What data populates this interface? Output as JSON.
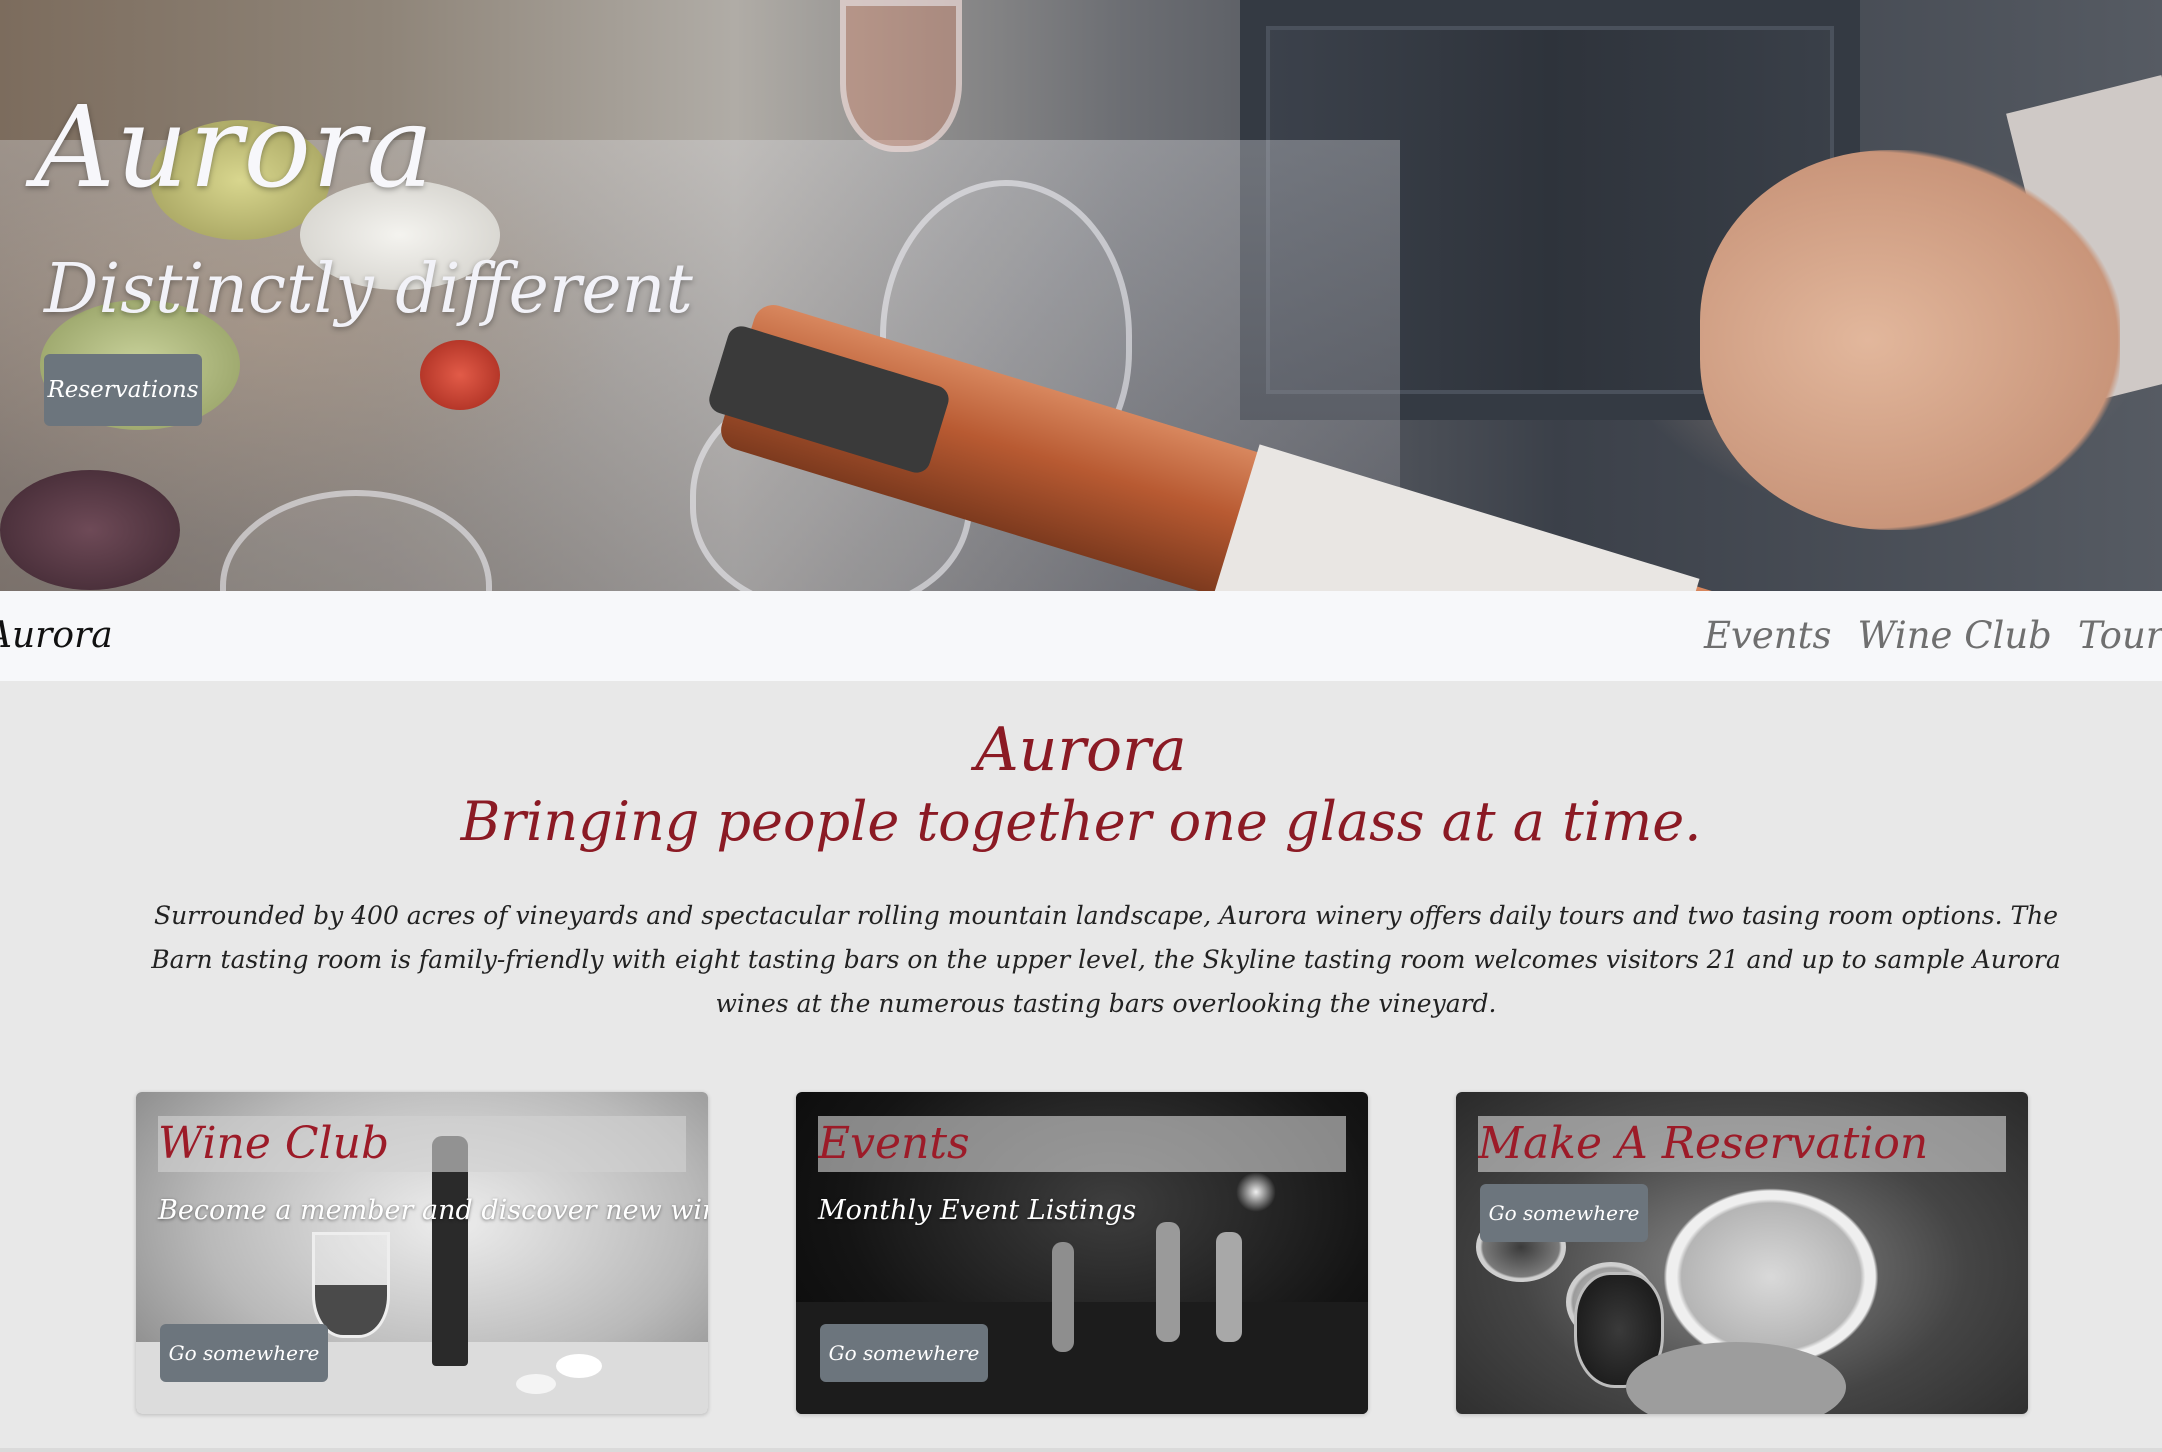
{
  "hero": {
    "title": "Aurora",
    "subtitle": "Distinctly different",
    "button_label": "Reservations"
  },
  "navbar": {
    "brand": "Aurora",
    "links": [
      {
        "label": "Events"
      },
      {
        "label": "Wine Club"
      },
      {
        "label": "Tours & Tasting"
      }
    ]
  },
  "intro": {
    "heading": "Aurora",
    "tagline": "Bringing people together one glass at a time.",
    "body": "Surrounded by 400 acres of vineyards and spectacular rolling mountain landscape, Aurora winery offers daily tours and two tasing room options. The Barn tasting room is family-friendly with eight tasting bars on the upper level, the Skyline tasting room welcomes visitors 21 and up to sample Aurora wines at the numerous tasting bars overlooking the vineyard."
  },
  "cards": [
    {
      "title": "Wine Club",
      "text": "Become a member and discover new wines!",
      "button_label": "Go somewhere"
    },
    {
      "title": "Events",
      "text": "Monthly Event Listings",
      "button_label": "Go somewhere"
    },
    {
      "title": "Make A Reservation",
      "text": "",
      "button_label": "Go somewhere"
    }
  ],
  "colors": {
    "accent_red": "#8b1a24",
    "button_gray": "#6c757d",
    "navbar_bg": "#f7f8fa",
    "page_bg": "#e8e8e8"
  }
}
